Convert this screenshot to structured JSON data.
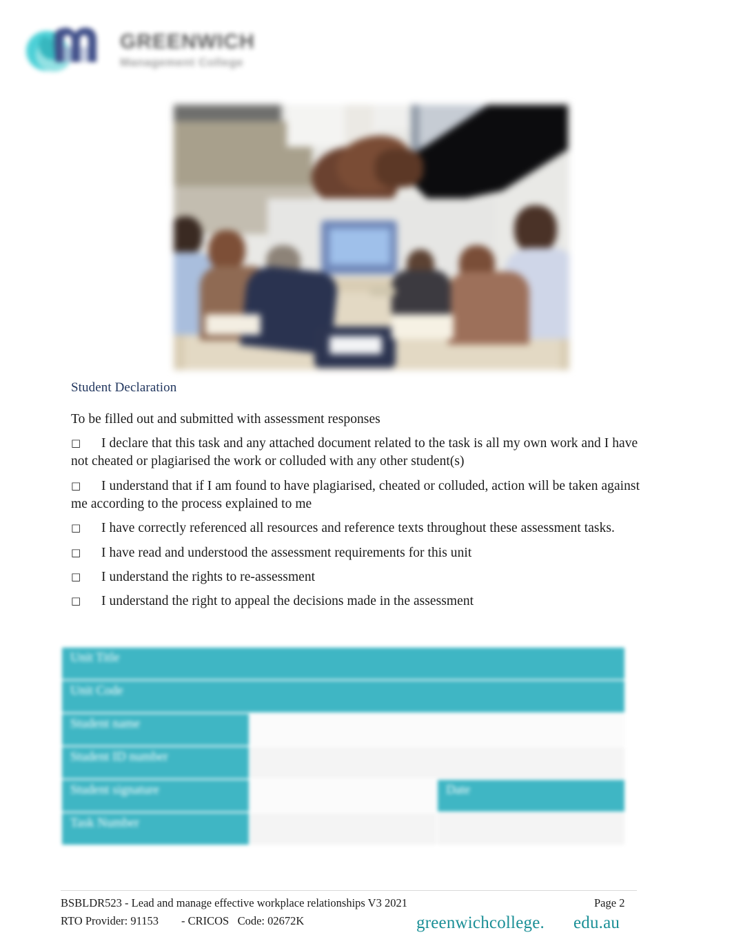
{
  "header": {
    "logo_icon": "gm-monogram-icon",
    "logo_name": "GREENWICH",
    "logo_sub": "Management College"
  },
  "hero": {
    "alt": "blurred photo of business handshake over boardroom meeting table"
  },
  "declaration": {
    "title": "Student Declaration",
    "intro": "To be filled out and submitted with assessment responses",
    "checkbox_glyph": "□",
    "items": [
      "I declare that this task and any attached document related to the task is all my own work and I have not cheated or plagiarised the work or colluded with any other student(s)",
      "I understand that if I am found to have plagiarised, cheated or colluded, action will be taken against me according to the process explained to me",
      "I have correctly referenced all resources and reference texts throughout these assessment tasks.",
      "I have read and understood the assessment requirements for this unit",
      "I understand the rights to re-assessment",
      "I understand the right to appeal the decisions made in the assessment"
    ]
  },
  "table": {
    "rows": [
      {
        "label": "Unit Title",
        "value": ""
      },
      {
        "label": "Unit Code",
        "value": ""
      },
      {
        "label": "Student name",
        "value": ""
      },
      {
        "label": "Student ID number",
        "value": ""
      },
      {
        "label": "Student signature",
        "value": "",
        "date_label": "Date",
        "date_value": ""
      },
      {
        "label": "Task Number",
        "value": "",
        "extra_value": ""
      }
    ]
  },
  "footer": {
    "doc_line": "BSBLDR523 - Lead and manage effective workplace relationships V3 2021",
    "rto_line": "RTO Provider: 91153        - CRICOS   Code: 02672K",
    "page": "Page 2",
    "url_part1": "greenwichcollege.",
    "url_part2": "edu.au"
  },
  "colors": {
    "teal": "#3fb6c4",
    "navy": "#21365e",
    "url_teal": "#1a8f96"
  }
}
